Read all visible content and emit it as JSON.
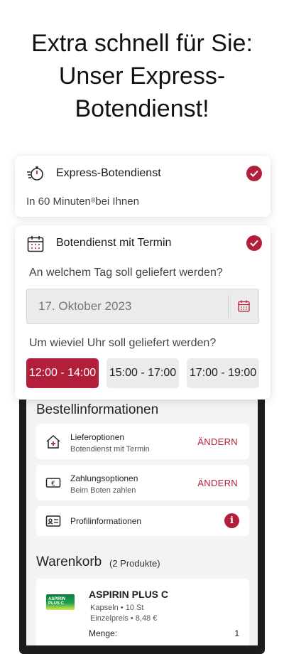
{
  "headline": [
    "Extra schnell für Sie:",
    "Unser Express-",
    "Botendienst!"
  ],
  "express": {
    "title": "Express-Botendienst",
    "subtitle": "In 60 Minuten⁸bei Ihnen",
    "icon": "stopwatch-icon",
    "checked": true
  },
  "appointment": {
    "title": "Botendienst mit Termin",
    "icon": "calendar-icon",
    "checked": true,
    "day_question": "An welchem Tag soll geliefert werden?",
    "date_value": "17. Oktober 2023",
    "time_question": "Um wieviel Uhr soll geliefert werden?",
    "slots": [
      {
        "label": "12:00 - 14:00",
        "selected": true
      },
      {
        "label": "15:00 - 17:00",
        "selected": false
      },
      {
        "label": "17:00 - 19:00",
        "selected": false
      }
    ]
  },
  "order_info": {
    "title": "Bestellinformationen",
    "delivery": {
      "label": "Lieferoptionen",
      "value": "Botendienst mit Termin",
      "action": "ÄNDERN"
    },
    "payment": {
      "label": "Zahlungsoptionen",
      "value": "Beim Boten zahlen",
      "action": "ÄNDERN"
    },
    "profile": {
      "label": "Profilinformationen"
    }
  },
  "cart": {
    "title": "Warenkorb",
    "count": "(2 Produkte)",
    "items": [
      {
        "image_text": "ASPIRIN PLUS C",
        "name": "ASPIRIN PLUS C",
        "detail": "Kapseln • 10 St",
        "price": "Einzelpreis • 8,48 €",
        "qty_label": "Menge:",
        "qty": "1"
      }
    ]
  },
  "colors": {
    "accent": "#b21f3b"
  }
}
